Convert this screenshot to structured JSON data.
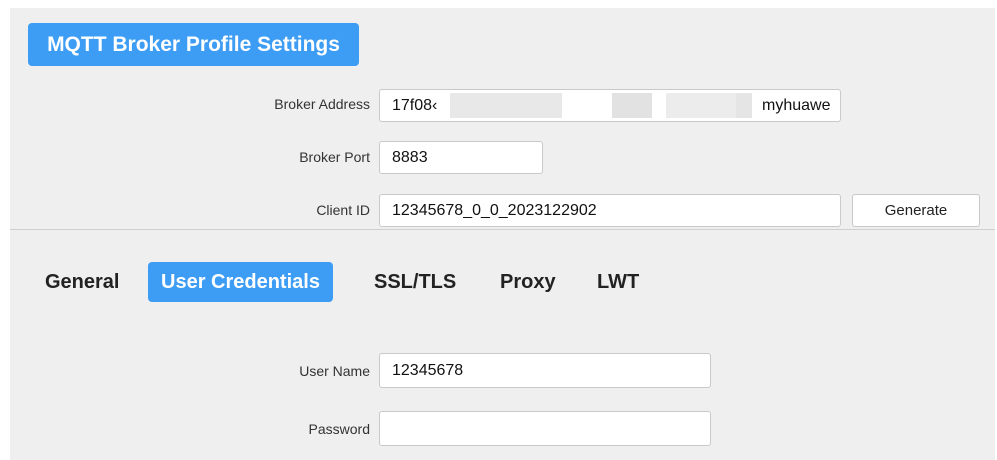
{
  "header": {
    "title": "MQTT Broker Profile Settings"
  },
  "broker": {
    "address_label": "Broker Address",
    "address_value_start": "17f08‹",
    "address_value_end": "myhuawe",
    "port_label": "Broker Port",
    "port_value": "8883",
    "client_id_label": "Client ID",
    "client_id_value": "12345678_0_0_2023122902",
    "generate_label": "Generate"
  },
  "tabs": [
    {
      "label": "General",
      "active": false
    },
    {
      "label": "User Credentials",
      "active": true
    },
    {
      "label": "SSL/TLS",
      "active": false
    },
    {
      "label": "Proxy",
      "active": false
    },
    {
      "label": "LWT",
      "active": false
    }
  ],
  "credentials": {
    "username_label": "User Name",
    "username_value": "12345678",
    "password_label": "Password",
    "password_value": ""
  },
  "colors": {
    "accent": "#3d9cf4",
    "panel_bg": "#efefef"
  }
}
